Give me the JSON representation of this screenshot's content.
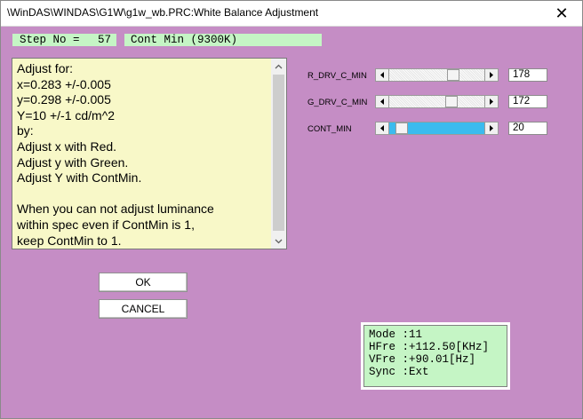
{
  "window": {
    "title": "\\WinDAS\\WINDAS\\G1W\\g1w_wb.PRC:White Balance Adjustment",
    "close_glyph": "✕"
  },
  "step": {
    "label": "Step No =",
    "number": "57"
  },
  "mode_label": "Cont Min (9300K)",
  "instructions": {
    "text": "Adjust for:\nx=0.283 +/-0.005\ny=0.298 +/-0.005\nY=10 +/-1 cd/m^2\nby:\nAdjust x with Red.\nAdjust y with Green.\nAdjust Y with ContMin.\n\nWhen you can not adjust luminance\nwithin spec even if ContMin is 1,\nkeep ContMin to 1."
  },
  "sliders": [
    {
      "label": "R_DRV_C_MIN",
      "value": "178",
      "position_fraction": 0.7
    },
    {
      "label": "G_DRV_C_MIN",
      "value": "172",
      "position_fraction": 0.68
    },
    {
      "label": "CONT_MIN",
      "value": "20",
      "position_fraction": 0.08
    }
  ],
  "buttons": {
    "ok": "OK",
    "cancel": "CANCEL"
  },
  "status_panel": {
    "lines": [
      "Mode :11",
      "HFre :+112.50[KHz]",
      "VFre :+90.01[Hz]",
      "Sync :Ext"
    ]
  },
  "colors": {
    "background": "#c58dc5",
    "green_panel": "#c5f5c5",
    "memo_background": "#f8f8c8",
    "slider_fill": "#3bbbee"
  },
  "icons": {
    "close": "close-icon",
    "scroll_up": "chevron-up-icon",
    "scroll_down": "chevron-down-icon",
    "scroll_left": "triangle-left-icon",
    "scroll_right": "triangle-right-icon"
  }
}
